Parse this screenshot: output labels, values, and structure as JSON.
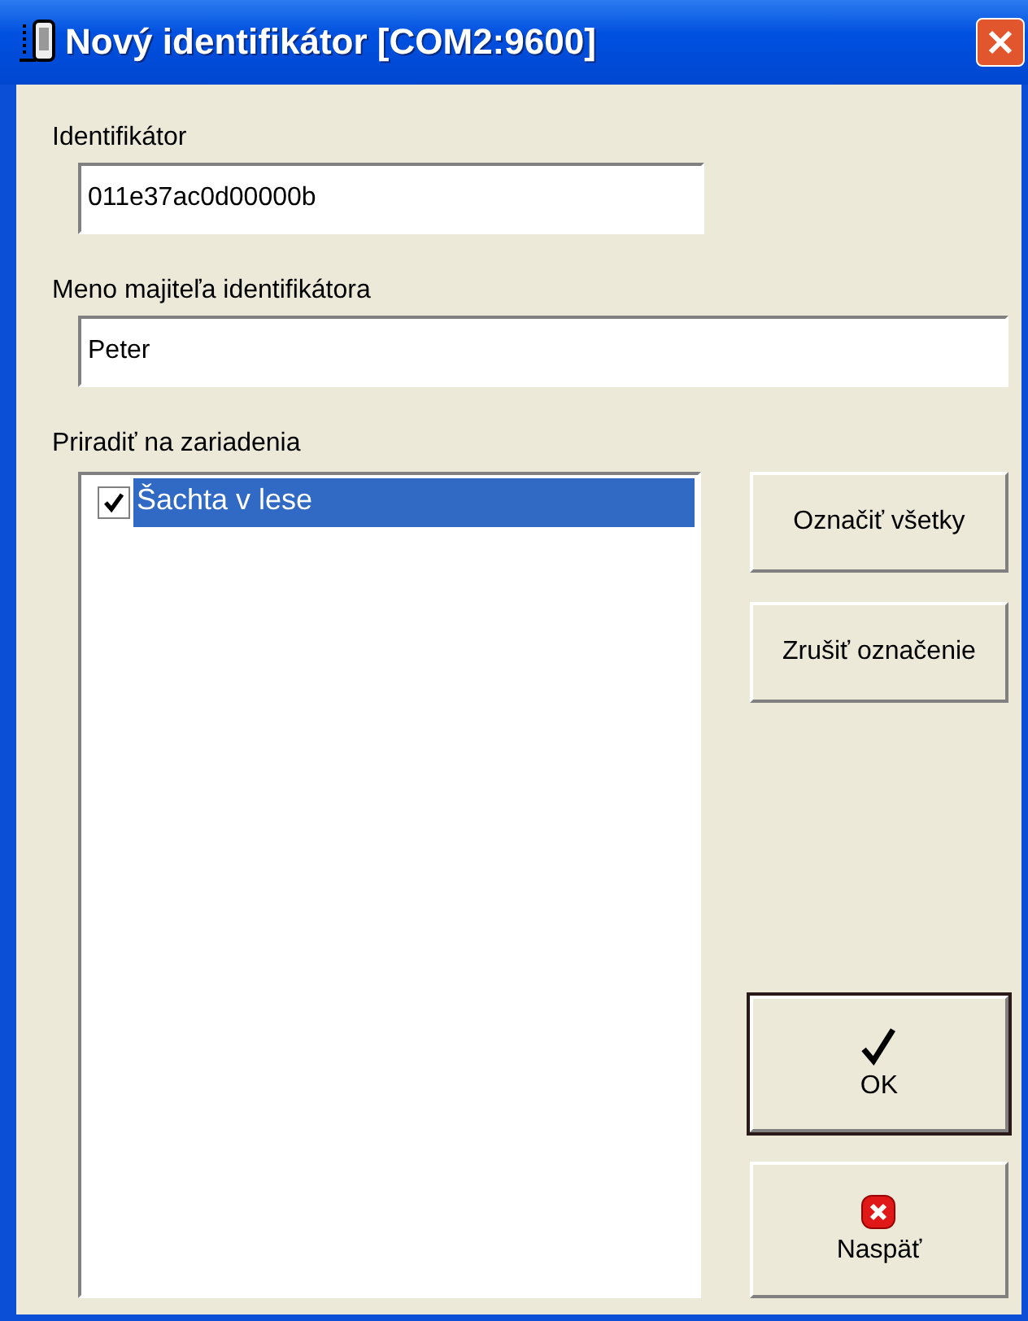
{
  "window": {
    "title": "Nový identifikátor [COM2:9600]"
  },
  "identifier": {
    "label": "Identifikátor",
    "value": "011e37ac0d00000b"
  },
  "owner": {
    "label": "Meno majiteľa identifikátora",
    "value": "Peter"
  },
  "devices": {
    "label": "Priradiť na zariadenia",
    "items": [
      {
        "name": "Šachta v lese",
        "checked": true,
        "selected": true
      }
    ]
  },
  "side_buttons": [
    {
      "label": "Označiť všetky"
    },
    {
      "label": "Zrušiť označenie"
    }
  ],
  "action_buttons": [
    {
      "kind": "ok",
      "label": "OK",
      "default": true
    },
    {
      "kind": "cancel",
      "label": "Naspäť",
      "default": false
    }
  ]
}
